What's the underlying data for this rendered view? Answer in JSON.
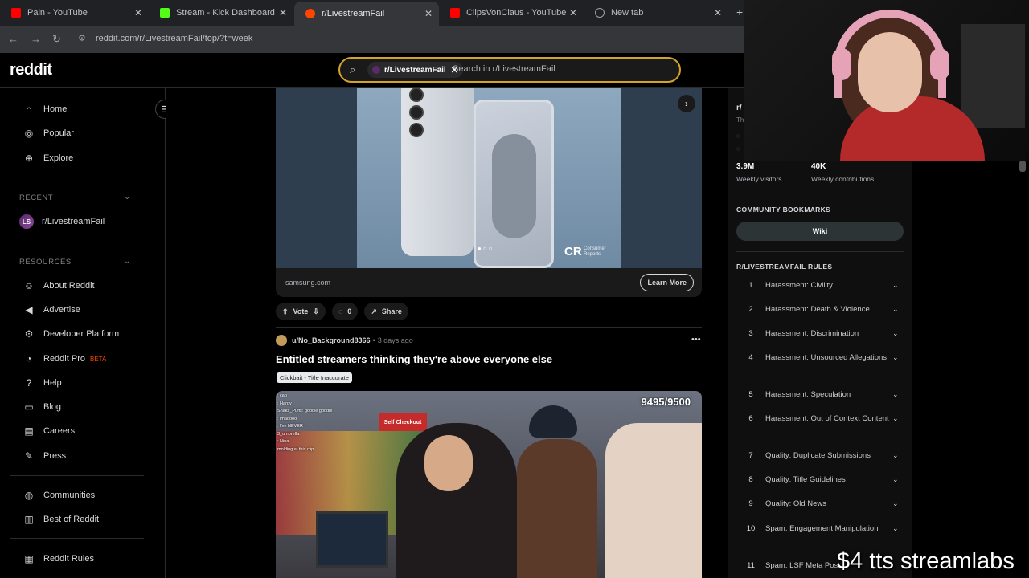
{
  "browser": {
    "tabs": [
      {
        "title": "Pain - YouTube",
        "favicon_color": "#ff0000"
      },
      {
        "title": "Stream - Kick Dashboard",
        "favicon_color": "#53fc18"
      },
      {
        "title": "r/LivestreamFail",
        "favicon_color": "#ff4500"
      },
      {
        "title": "ClipsVonClaus - YouTube",
        "favicon_color": "#ff0000"
      },
      {
        "title": "New tab",
        "favicon_color": "#9aa0a6"
      }
    ],
    "url": "reddit.com/r/LivestreamFail/top/?t=week"
  },
  "header": {
    "logo": "reddit",
    "search_chip": "r/LivestreamFail",
    "search_placeholder": "Search in r/LivestreamFail"
  },
  "sidebar": {
    "main": [
      {
        "label": "Home",
        "icon": "home-icon"
      },
      {
        "label": "Popular",
        "icon": "popular-icon"
      },
      {
        "label": "Explore",
        "icon": "explore-icon"
      }
    ],
    "recent_heading": "RECENT",
    "recent": [
      {
        "label": "r/LivestreamFail",
        "avatar": "LS"
      }
    ],
    "resources_heading": "RESOURCES",
    "resources": [
      {
        "label": "About Reddit",
        "icon": "about-icon"
      },
      {
        "label": "Advertise",
        "icon": "advertise-icon"
      },
      {
        "label": "Developer Platform",
        "icon": "developer-icon"
      },
      {
        "label": "Reddit Pro",
        "icon": "pro-icon",
        "badge": "BETA"
      },
      {
        "label": "Help",
        "icon": "help-icon"
      },
      {
        "label": "Blog",
        "icon": "blog-icon"
      },
      {
        "label": "Careers",
        "icon": "careers-icon"
      },
      {
        "label": "Press",
        "icon": "press-icon"
      }
    ],
    "bottom": [
      {
        "label": "Communities",
        "icon": "communities-icon"
      },
      {
        "label": "Best of Reddit",
        "icon": "best-icon"
      }
    ],
    "rules_link": "Reddit Rules"
  },
  "ad": {
    "domain": "samsung.com",
    "cta": "Learn More",
    "brand_mark": "CR",
    "brand_text": "Consumer Reports"
  },
  "ad_actions": {
    "vote": "Vote",
    "comments": "0",
    "share": "Share"
  },
  "post": {
    "author": "u/No_Background8366",
    "time": "3 days ago",
    "title": "Entitled streamers thinking they're above everyone else",
    "flair": "Clickbait - Title Inaccurate",
    "counter": "9495/9500",
    "store_sign": "Self Checkout",
    "chat_lines": [
      ": cap",
      ": Hardy",
      "Snaks_Puffs: goodie goodie",
      ": lmaoooo",
      ": I've NEVER",
      "3_umbrella: ",
      ": Nina",
      "molding at this clip"
    ]
  },
  "community": {
    "name_partial": "r/",
    "tagline_partial": "Th",
    "visitors": "3.9M",
    "visitors_label": "Weekly visitors",
    "contributions": "40K",
    "contributions_label": "Weekly contributions",
    "bookmarks_heading": "COMMUNITY BOOKMARKS",
    "wiki": "Wiki",
    "rules_heading": "R/LIVESTREAMFAIL RULES",
    "rules": [
      {
        "num": "1",
        "text": "Harassment: Civility"
      },
      {
        "num": "2",
        "text": "Harassment: Death & Violence"
      },
      {
        "num": "3",
        "text": "Harassment: Discrimination"
      },
      {
        "num": "4",
        "text": "Harassment: Unsourced Allegations"
      },
      {
        "num": "5",
        "text": "Harassment: Speculation"
      },
      {
        "num": "6",
        "text": "Harassment: Out of Context Content"
      },
      {
        "num": "7",
        "text": "Quality: Duplicate Submissions"
      },
      {
        "num": "8",
        "text": "Quality: Title Guidelines"
      },
      {
        "num": "9",
        "text": "Quality: Old News"
      },
      {
        "num": "10",
        "text": "Spam: Engagement Manipulation"
      },
      {
        "num": "11",
        "text": "Spam: LSF Meta Post"
      }
    ]
  },
  "overlay": {
    "text": "$4 tts streamlabs"
  }
}
